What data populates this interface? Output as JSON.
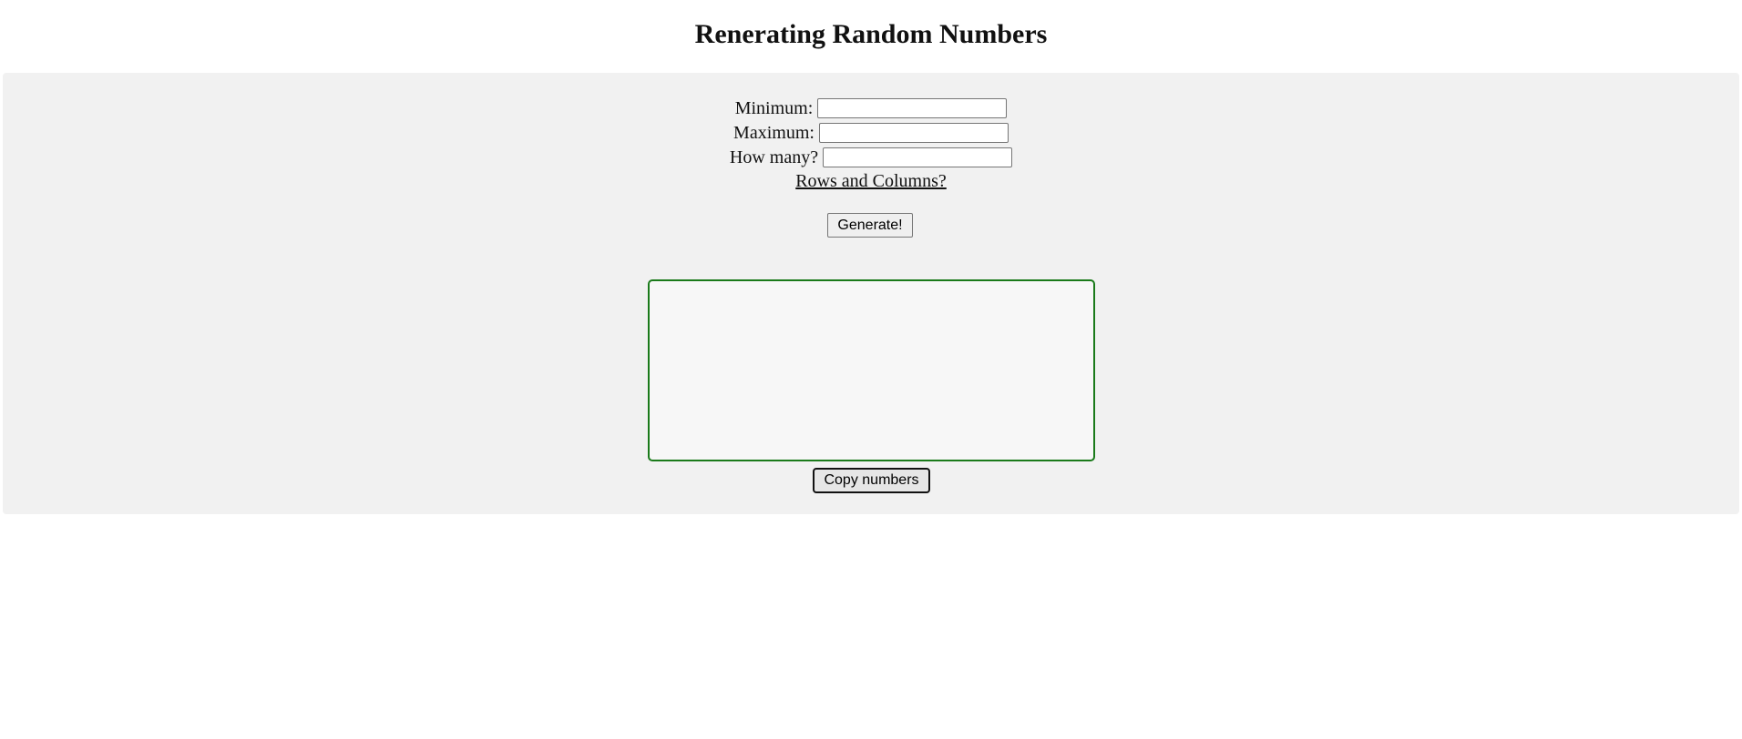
{
  "page": {
    "title": "Renerating Random Numbers"
  },
  "form": {
    "minimum_label": "Minimum:",
    "minimum_value": "",
    "maximum_label": "Maximum:",
    "maximum_value": "",
    "how_many_label": "How many?",
    "how_many_value": "",
    "rows_columns_link": "Rows and Columns?",
    "generate_label": "Generate!"
  },
  "output": {
    "numbers_text": "",
    "border_color": "#1a7a1a"
  },
  "actions": {
    "copy_label": "Copy numbers"
  }
}
